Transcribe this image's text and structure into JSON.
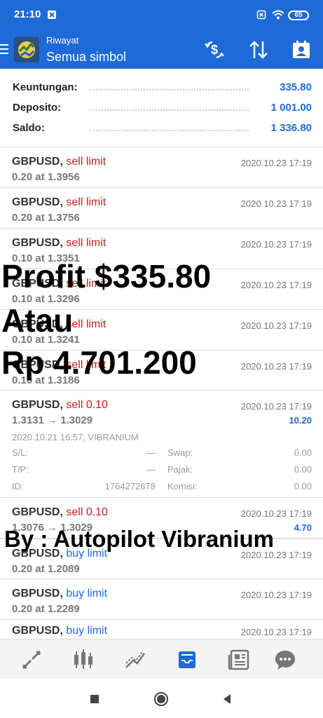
{
  "status_bar": {
    "time": "21:10",
    "battery": "65"
  },
  "header": {
    "subtitle": "Riwayat",
    "title": "Semua simbol"
  },
  "summary": [
    {
      "label": "Keuntungan:",
      "value": "335.80"
    },
    {
      "label": "Deposito:",
      "value": "1 001.00"
    },
    {
      "label": "Saldo:",
      "value": "1 336.80"
    }
  ],
  "orders": [
    {
      "symbol": "GBPUSD,",
      "type": "sell limit",
      "qty": "0.20 at 1.3956",
      "time": "2020.10.23 17:19"
    },
    {
      "symbol": "GBPUSD,",
      "type": "sell limit",
      "qty": "0.20 at 1.3756",
      "time": "2020.10.23 17:19"
    },
    {
      "symbol": "GBPUSD,",
      "type": "sell limit",
      "qty": "0.10 at 1.3351",
      "time": "2020.10.23 17:19"
    },
    {
      "symbol": "GBPUSD,",
      "type": "sell limit",
      "qty": "0.10 at 1.3296",
      "time": "2020.10.23 17:19"
    },
    {
      "symbol": "GBPUSD,",
      "type": "sell limit",
      "qty": "0.10 at 1.3241",
      "time": "2020.10.23 17:19"
    },
    {
      "symbol": "GBPUSD,",
      "type": "sell limit",
      "qty": "0.10 at 1.3186",
      "time": "2020.10.23 17:19"
    }
  ],
  "expanded_deal": {
    "symbol": "GBPUSD,",
    "type": "sell 0.10",
    "prices": "1.3131 → 1.3029",
    "time": "2020.10.23 17:19",
    "profit": "10.20",
    "info": "2020.10.21 16:57, VIBRANIUM",
    "sl_label": "S/L:",
    "sl_value": "—",
    "tp_label": "T/P:",
    "tp_value": "—",
    "id_label": "ID:",
    "id_value": "1764272678",
    "swap_label": "Swap:",
    "swap_value": "0.00",
    "tax_label": "Pajak:",
    "tax_value": "0.00",
    "commission_label": "Komisi:",
    "commission_value": "0.00"
  },
  "deal2": {
    "symbol": "GBPUSD,",
    "type": "sell 0.10",
    "prices": "1.3076 → 1.3029",
    "time": "2020.10.23 17:19",
    "profit": "4.70"
  },
  "buy_orders": [
    {
      "symbol": "GBPUSD,",
      "type": "buy limit",
      "qty": "0.20 at 1.2089",
      "time": "2020.10.23 17:19"
    },
    {
      "symbol": "GBPUSD,",
      "type": "buy limit",
      "qty": "0.20 at 1.2289",
      "time": "2020.10.23 17:19"
    },
    {
      "symbol": "GBPUSD,",
      "type": "buy limit",
      "qty": "",
      "time": "2020.10.23 17:19"
    }
  ],
  "overlay": {
    "line1": "Profit $335.80",
    "line2": "Atau",
    "line3": "Rp 4.701.200",
    "line4": "By : Autopilot Vibranium"
  },
  "colors": {
    "primary": "#1e6ad6",
    "sell": "#d0191f",
    "buy": "#1e6ad6"
  },
  "nav_icons": [
    "trade-icon",
    "chart-icon",
    "indicator-icon",
    "history-icon",
    "news-icon",
    "chat-icon"
  ]
}
